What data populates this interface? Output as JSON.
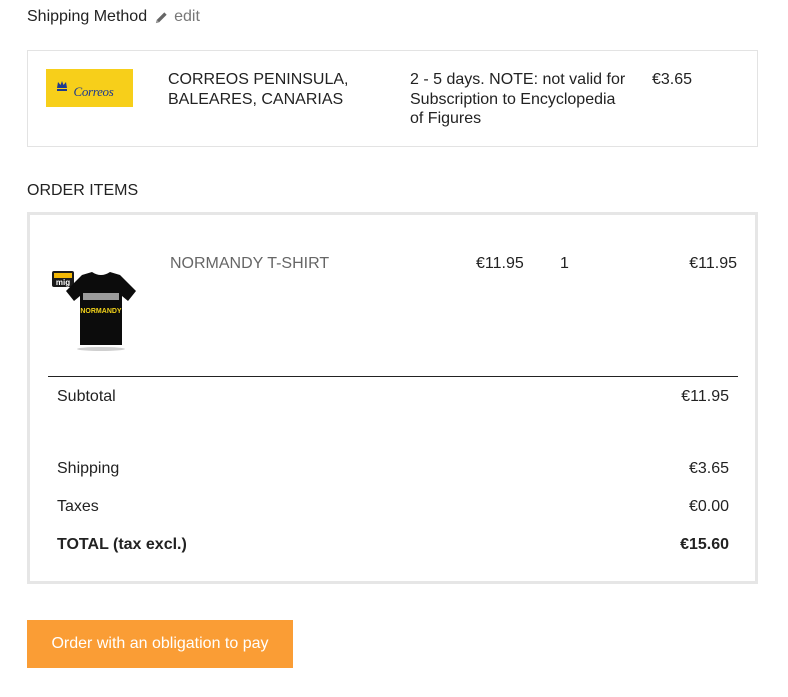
{
  "shipping": {
    "title": "Shipping Method",
    "edit_label": "edit",
    "carrier": {
      "logo_text": "Correos",
      "name": "CORREOS PENINSULA, BALEARES, CANARIAS",
      "delay": "2 - 5 days. NOTE: not valid for Subscription to Encyclopedia of Figures",
      "price": "€3.65"
    }
  },
  "order": {
    "heading": "ORDER ITEMS",
    "items": [
      {
        "name": "NORMANDY T-SHIRT",
        "unit_price": "€11.95",
        "quantity": "1",
        "total": "€11.95",
        "image_brand": "mig",
        "image_text": "NORMANDY"
      }
    ],
    "summary": {
      "subtotal_label": "Subtotal",
      "subtotal_value": "€11.95",
      "shipping_label": "Shipping",
      "shipping_value": "€3.65",
      "taxes_label": "Taxes",
      "taxes_value": "€0.00",
      "total_label": "TOTAL (tax excl.)",
      "total_value": "€15.60"
    }
  },
  "actions": {
    "pay_label": "Order with an obligation to pay"
  },
  "colors": {
    "accent": "#fa9d35",
    "carrier_brand": "#f7cf1a",
    "carrier_text": "#1d3a8f"
  }
}
